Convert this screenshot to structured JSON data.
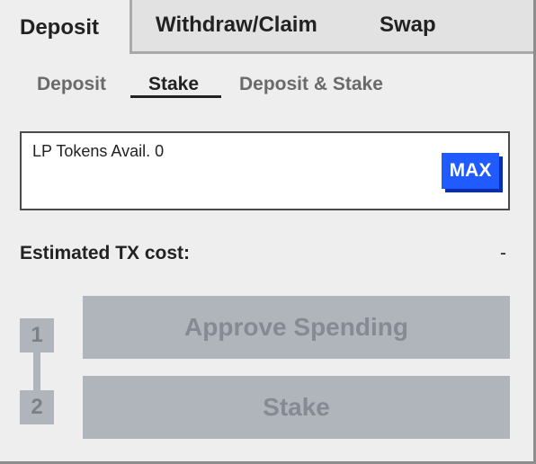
{
  "top_tabs": {
    "deposit": "Deposit",
    "withdraw_claim": "Withdraw/Claim",
    "swap": "Swap"
  },
  "sub_tabs": {
    "deposit": "Deposit",
    "stake": "Stake",
    "deposit_stake": "Deposit & Stake"
  },
  "token_input": {
    "label": "LP Tokens Avail. 0",
    "max_label": "MAX"
  },
  "tx_cost": {
    "label": "Estimated TX cost:",
    "value": "-"
  },
  "steps": [
    {
      "number": "1",
      "label": "Approve Spending"
    },
    {
      "number": "2",
      "label": "Stake"
    }
  ],
  "colors": {
    "accent": "#1f5bff",
    "disabled": "#b0b4bb",
    "background": "#eeeeee"
  }
}
